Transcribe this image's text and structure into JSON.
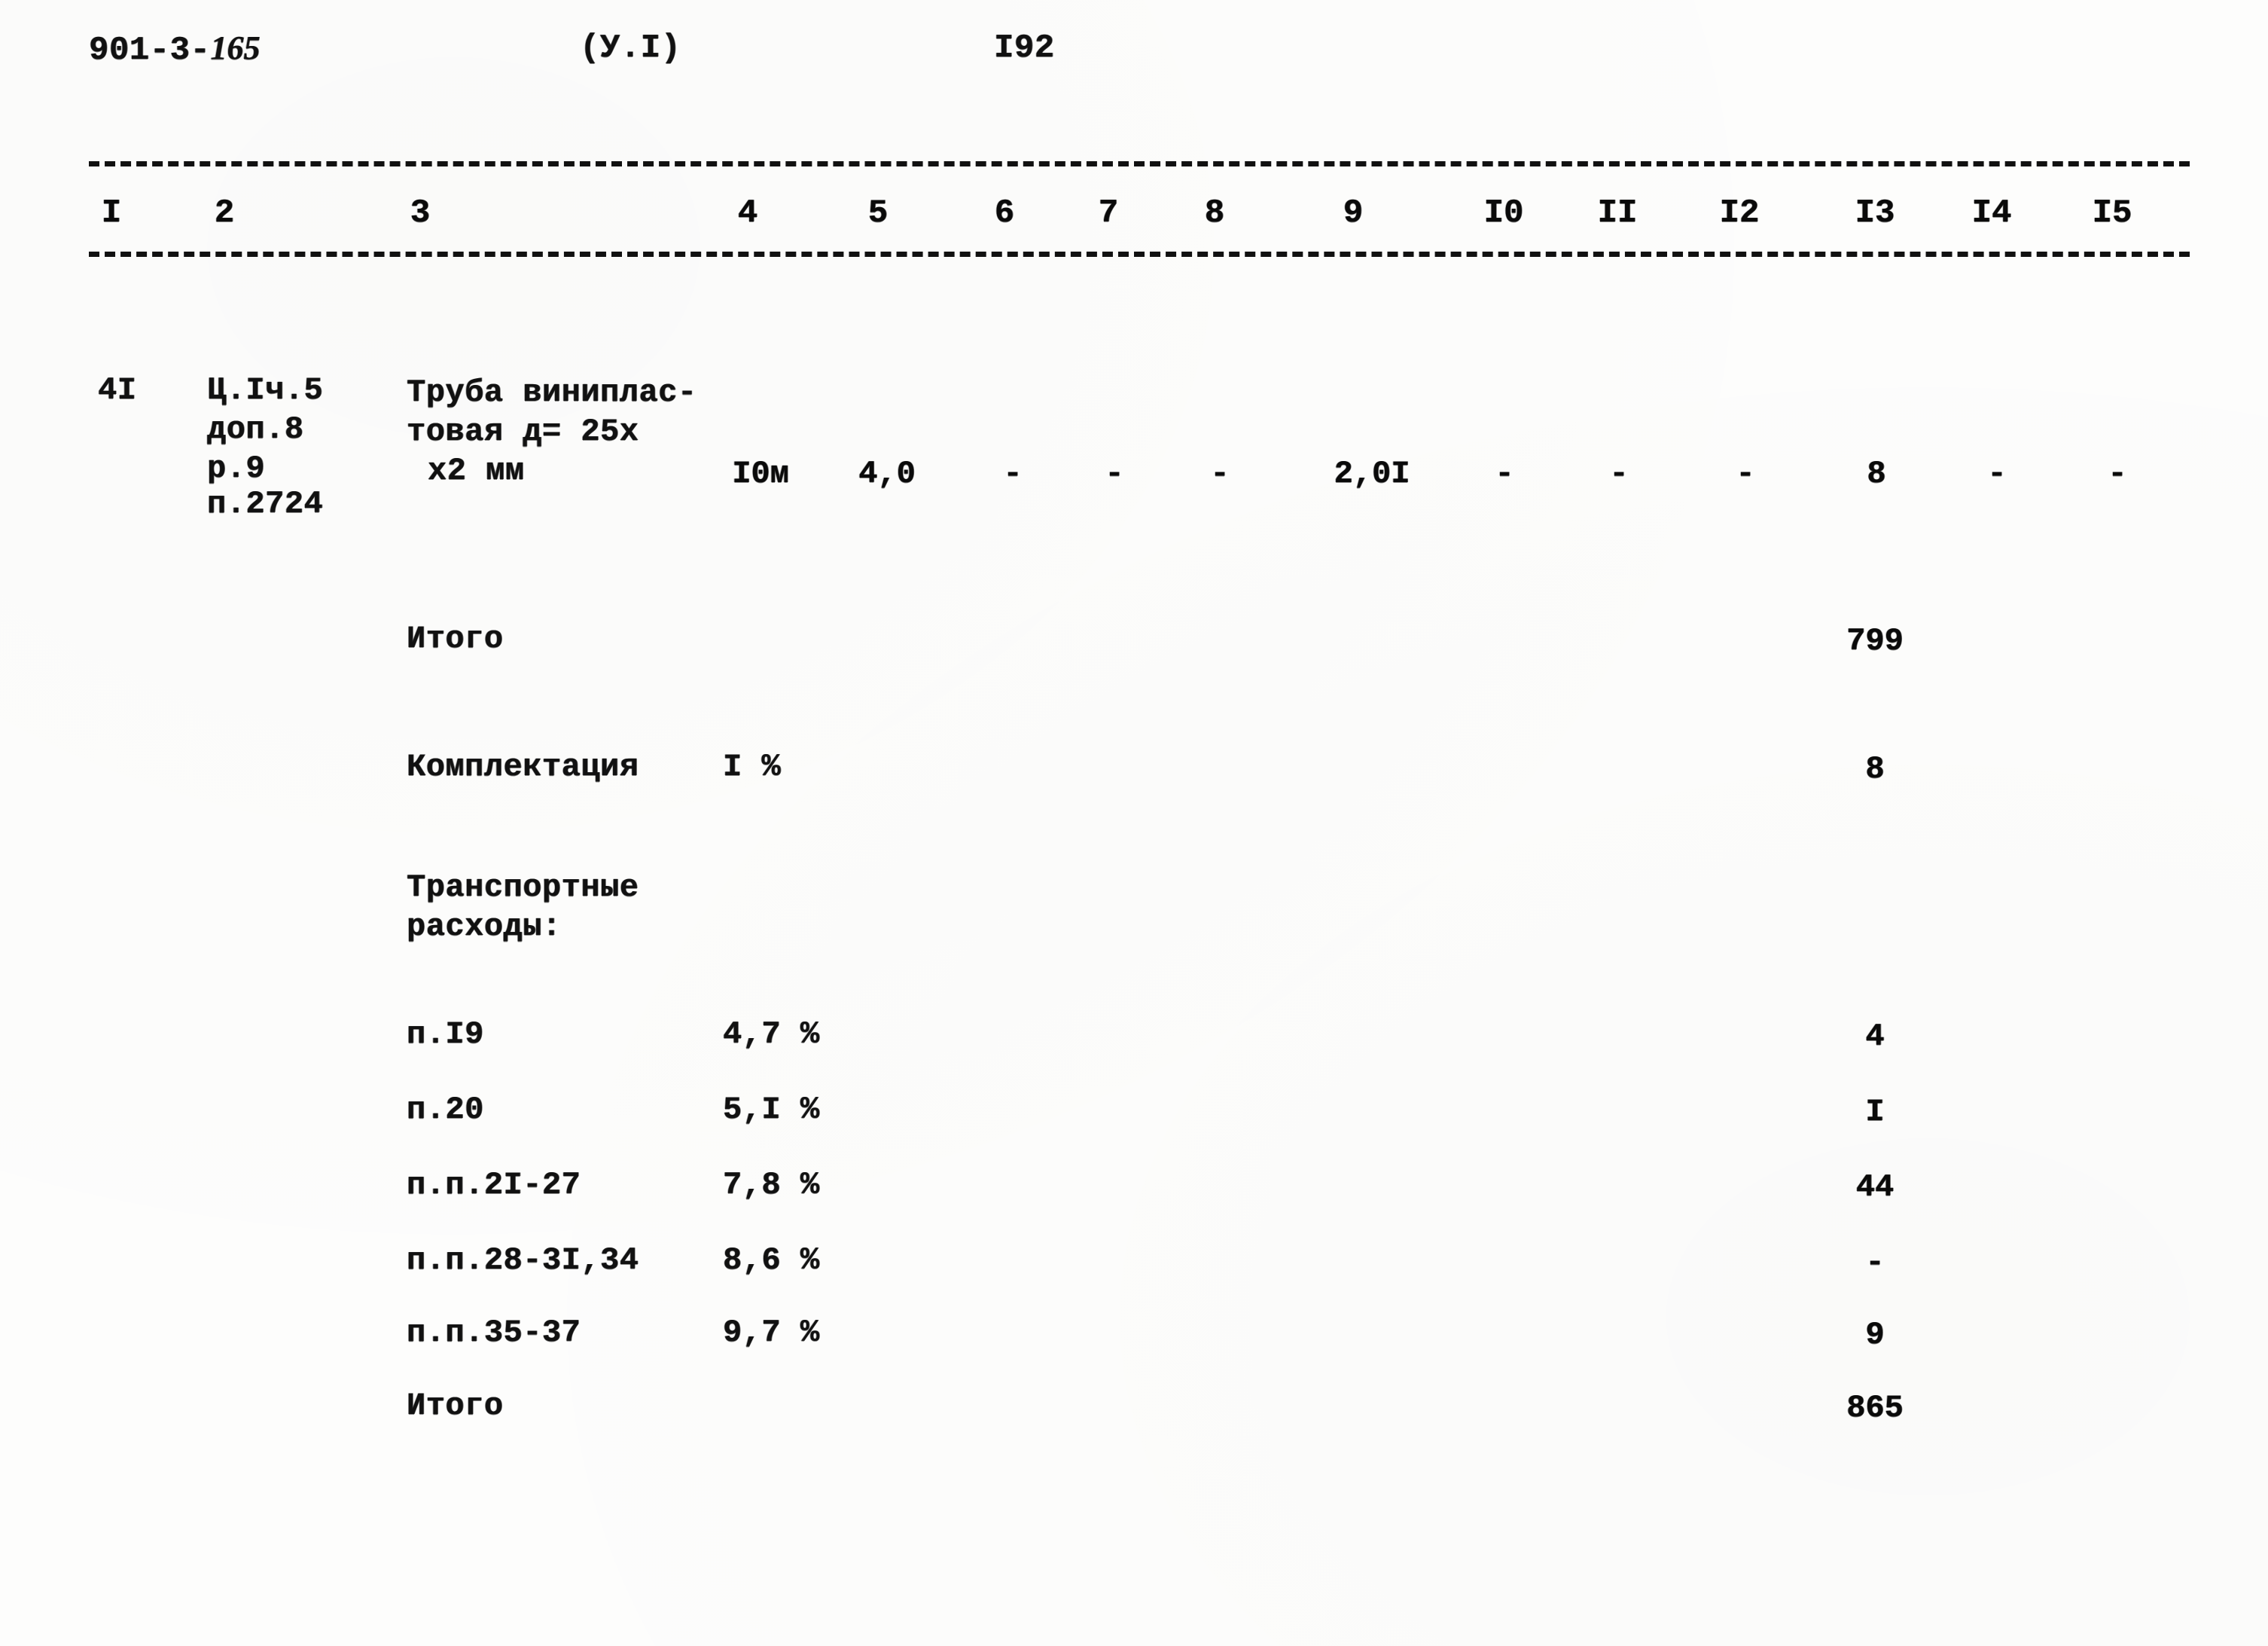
{
  "header": {
    "doc_number_prefix": "901-3-",
    "doc_number_handwritten": "165",
    "series": "(У.I)",
    "page_number": "I92"
  },
  "table": {
    "column_numbers": [
      "I",
      "2",
      "3",
      "4",
      "5",
      "6",
      "7",
      "8",
      "9",
      "I0",
      "II",
      "I2",
      "I3",
      "I4",
      "I5"
    ],
    "row": {
      "index": "4I",
      "code_lines": [
        "Ц.Iч.5",
        "доп.8",
        "р.9",
        "п.2724"
      ],
      "description_lines": [
        "Труба виниплас-",
        "товая д= 25х",
        "х2 мм"
      ],
      "unit": "I0м",
      "col5": "4,0",
      "col6": "-",
      "col7": "-",
      "col8": "-",
      "col9": "2,0I",
      "col10": "-",
      "col11": "-",
      "col12": "-",
      "col13": "8",
      "col14": "-",
      "col15": "-"
    },
    "subtotal": {
      "label": "Итого",
      "value": "799"
    },
    "completion": {
      "label": "Комплектация",
      "percent": "I %",
      "value": "8"
    },
    "transport": {
      "heading_lines": [
        "Транспортные",
        "расходы:"
      ],
      "items": [
        {
          "label": "п.I9",
          "percent": "4,7 %",
          "value": "4"
        },
        {
          "label": "п.20",
          "percent": "5,I %",
          "value": "I"
        },
        {
          "label": "п.п.2I-27",
          "percent": "7,8 %",
          "value": "44"
        },
        {
          "label": "п.п.28-3I,34",
          "percent": "8,6 %",
          "value": "-"
        },
        {
          "label": "п.п.35-37",
          "percent": "9,7 %",
          "value": "9"
        }
      ]
    },
    "total": {
      "label": "Итого",
      "value": "865"
    }
  }
}
